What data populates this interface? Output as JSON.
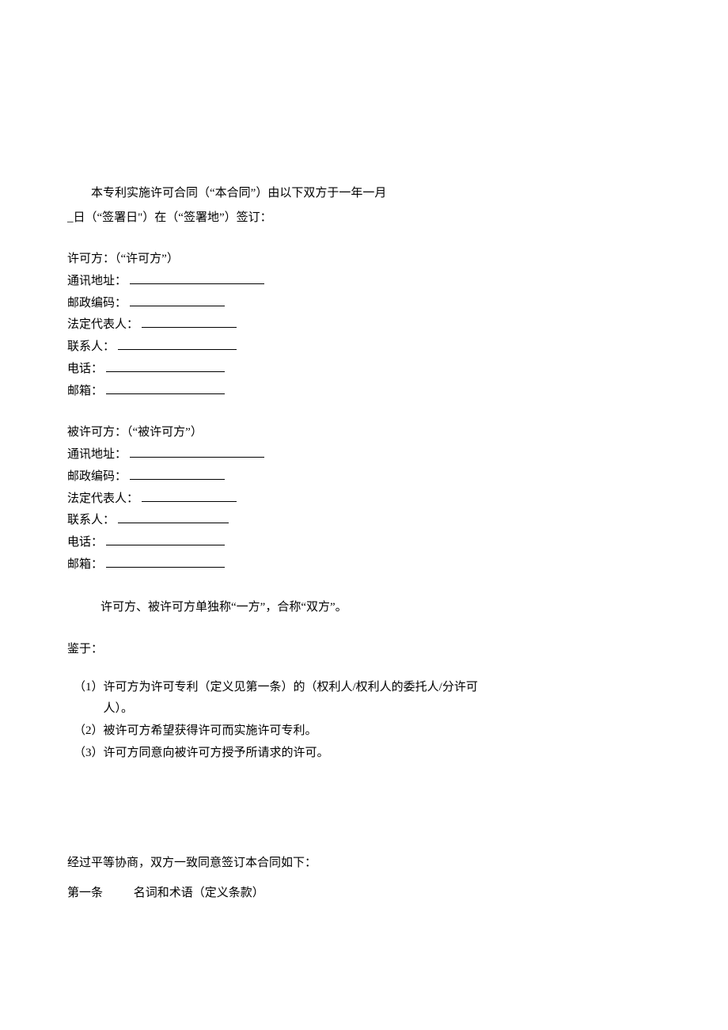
{
  "intro": {
    "line1": "本专利实施许可合同（“本合同”）由以下双方于一年一月",
    "line2": "_日（“签署日\"）在（“签署地”）签订："
  },
  "licensor": {
    "heading": "许可方：（“许可方”）",
    "address_label": "通讯地址：",
    "postal_label": "邮政编码：",
    "legal_rep_label": "法定代表人：",
    "contact_label": "联系人：",
    "phone_label": "电话：",
    "email_label": "邮箱："
  },
  "licensee": {
    "heading": "被许可方：（“被许可方”）",
    "address_label": "通讯地址：",
    "postal_label": "邮政编码：",
    "legal_rep_label": "法定代表人：",
    "contact_label": "联系人：",
    "phone_label": "电话：",
    "email_label": "邮箱："
  },
  "reference": "许可方、被许可方单独称“一方”，合称“双方”。",
  "whereas_label": "鉴于：",
  "recitals": {
    "r1a": "（1）许可方为许可专利（定义见第一条）的（权利人/权利人的委托人/分许可",
    "r1b": "人）。",
    "r2": "（2）被许可方希望获得许可而实施许可专利。",
    "r3": "（3）许可方同意向被许可方授予所请求的许可。"
  },
  "closing": "经过平等协商，双方一致同意签订本合同如下：",
  "article1": {
    "number": "第一条",
    "title": "名词和术语（定义条款）"
  }
}
